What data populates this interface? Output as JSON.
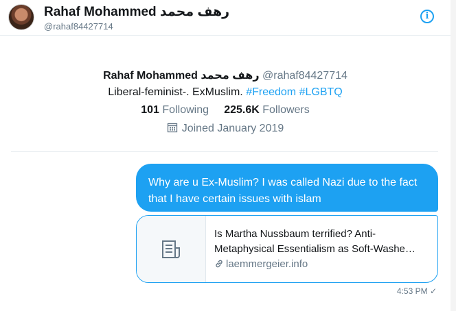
{
  "header": {
    "name": "Rahaf Mohammed رهف محمد",
    "handle": "@rahaf84427714",
    "info_icon": "info-icon"
  },
  "profile": {
    "name": "Rahaf Mohammed رهف محمد",
    "handle": "@rahaf84427714",
    "bio_text": "Liberal-feminist-. ExMuslim.",
    "bio_hashtag_1": "#Freedom",
    "bio_hashtag_2": "#LGBTQ",
    "following_count": "101",
    "following_label": "Following",
    "followers_count": "225.6K",
    "followers_label": "Followers",
    "joined": "Joined January 2019"
  },
  "message": {
    "text": "Why are u Ex-Muslim? I was called Nazi due to the fact that I have certain issues with islam",
    "card_title": "Is Martha Nussbaum terrified? Anti-Metaphysical Essentialism as Soft-Washe…",
    "card_domain": "laemmergeier.info",
    "timestamp": "4:53 PM",
    "status_icon": "checkmark-icon"
  },
  "colors": {
    "accent": "#1da1f2",
    "muted": "#657786",
    "text": "#14171a"
  }
}
